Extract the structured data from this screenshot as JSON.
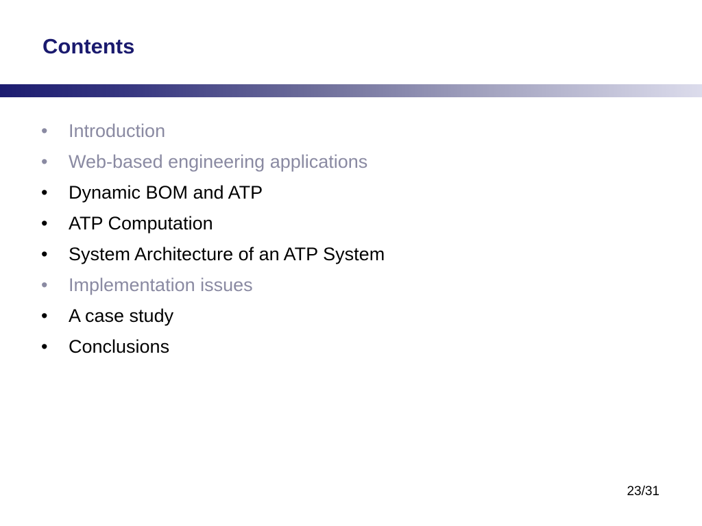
{
  "slide": {
    "title": "Contents",
    "bullet_glyph": "•",
    "items": [
      {
        "label": "Introduction",
        "color": "#8a8aa2"
      },
      {
        "label": "Web-based engineering applications",
        "color": "#8a8aa2"
      },
      {
        "label": "Dynamic BOM and ATP",
        "color": "#000000"
      },
      {
        "label": "ATP Computation",
        "color": "#000000"
      },
      {
        "label": "System Architecture of an ATP System",
        "color": "#000000"
      },
      {
        "label": "Implementation issues",
        "color": "#8a8aa2"
      },
      {
        "label": "A case study",
        "color": "#000000"
      },
      {
        "label": "Conclusions",
        "color": "#000000"
      }
    ],
    "page_number": "23/31",
    "colors": {
      "title": "#1a1a6e",
      "accent_bar_start": "#1c1c70",
      "accent_bar_end": "#dcdcec",
      "active_item": "#000000",
      "dimmed_item": "#8a8aa2"
    }
  }
}
